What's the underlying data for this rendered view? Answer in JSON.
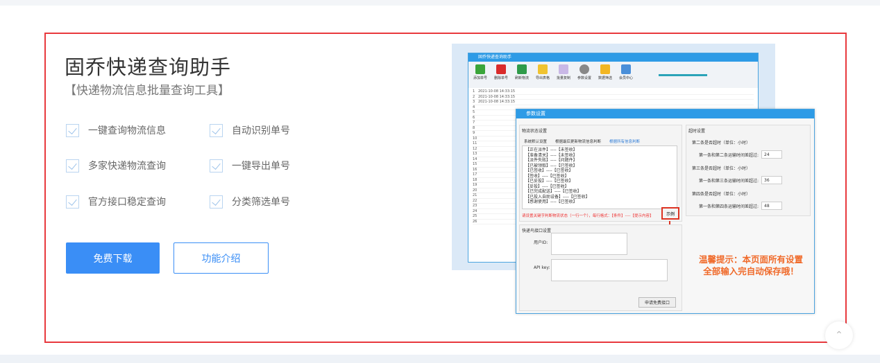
{
  "title": "固乔快递查询助手",
  "subtitle": "【快递物流信息批量查询工具】",
  "features": [
    "一键查询物流信息",
    "自动识别单号",
    "多家快递物流查询",
    "一键导出单号",
    "官方接口稳定查询",
    "分类筛选单号"
  ],
  "buttons": {
    "download": "免费下载",
    "intro": "功能介绍"
  },
  "screenshot": {
    "app_title": "固乔快递查询助手",
    "toolbar": [
      "添加单号",
      "删除单号",
      "刷新物流",
      "导出表格",
      "批量复制",
      "参数设置",
      "数据筛选",
      "会员中心"
    ],
    "dialog_title": "参数设置",
    "status_group": "物流状态设置",
    "radio_options": [
      "系统默认设置",
      "根据最后更新物流信息判断",
      "根据所有信息判断"
    ],
    "status_list": [
      "【正在派件】----【未签收】",
      "【准备清关】----【未签收】",
      "【派件失败】----【问题件】",
      "【已被领取】----【已签收】",
      "【已签收】----【已签收】",
      "【签收】----【已签收】",
      "【已妥投】----【已签收】",
      "【妥投】----【已签收】",
      "【已完成配送】----【已签收】",
      "【已投入自助设备】----【已签收】",
      "【感谢使用】----【已签收】"
    ],
    "red_tip": "请设置关键字判断物流状态（一行一个），每行格式：【条件】----【提示内容】",
    "example_button": "示例",
    "api_group": "快递鸟接口设置",
    "user_id_label": "用户ID:",
    "api_key_label": "API key:",
    "apply_button": "申请免费接口",
    "timeout_group": "超时设置",
    "timeouts": [
      {
        "heading": "第二条是否超时（单位：小时）",
        "label": "第一条和第二条运输时间差超过:",
        "value": "24"
      },
      {
        "heading": "第三条是否超时（单位：小时）",
        "label": "第一条和第三条运输时间差超过:",
        "value": "36"
      },
      {
        "heading": "第四条是否超时（单位：小时）",
        "label": "第一条和第四条运输时间差超过:",
        "value": "48"
      }
    ],
    "warm_tip_line1": "温馨提示：本页面所有设置",
    "warm_tip_line2": "全部输入完自动保存哦！"
  },
  "icons": {
    "back_to_top": "chevron-up-icon",
    "checkbox": "check-icon"
  }
}
